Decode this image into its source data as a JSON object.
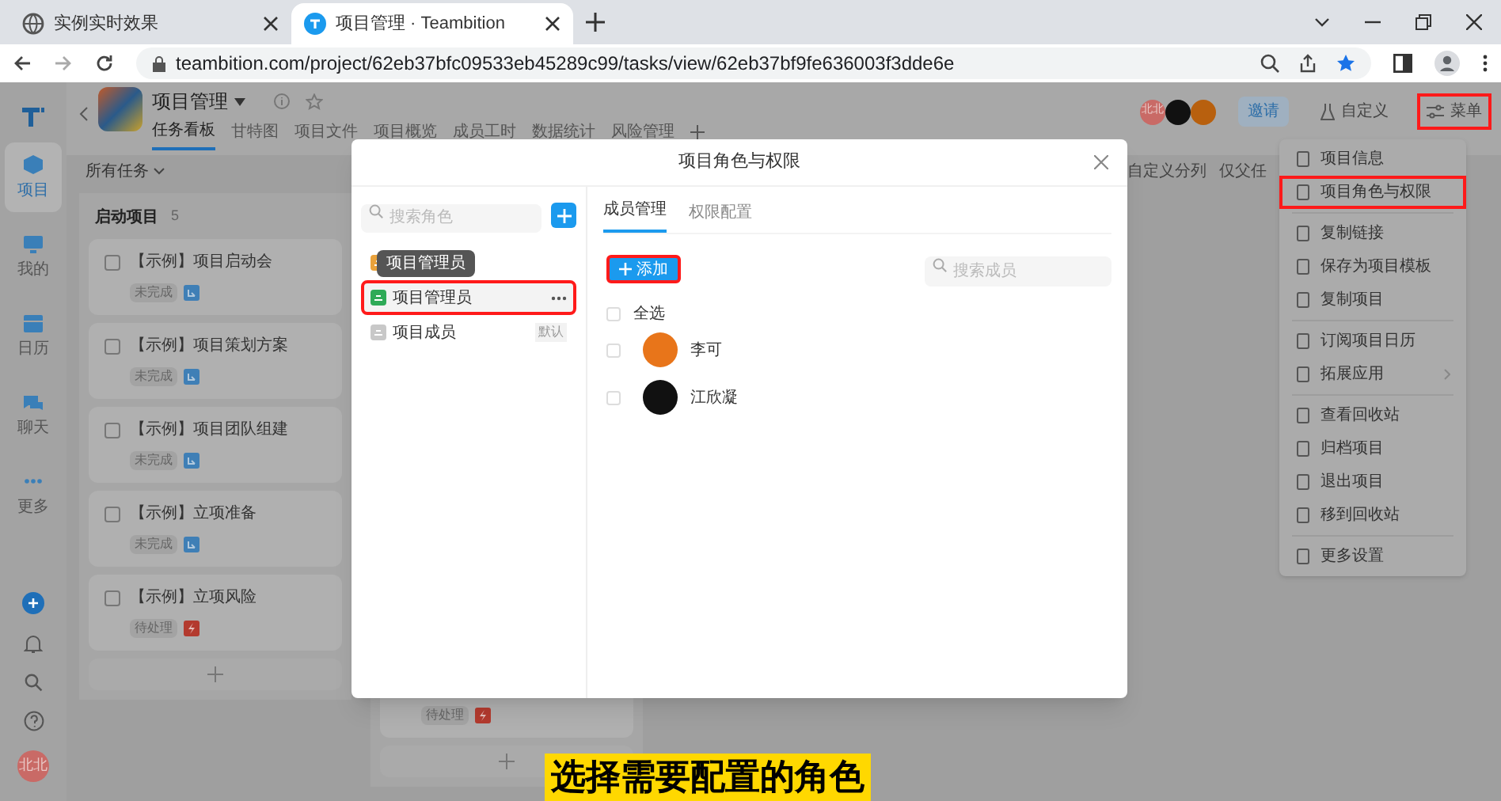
{
  "browser": {
    "tabs": [
      {
        "title": "实例实时效果",
        "selected": false
      },
      {
        "title": "项目管理 · Teambition",
        "selected": true
      }
    ],
    "url": "teambition.com/project/62eb37bfc09533eb45289c99/tasks/view/62eb37bf9fe636003f3dde6e"
  },
  "sidebar": {
    "items": [
      {
        "label": "项目",
        "selected": true
      },
      {
        "label": "我的",
        "selected": false
      },
      {
        "label": "日历",
        "selected": false
      },
      {
        "label": "聊天",
        "selected": false
      },
      {
        "label": "更多",
        "selected": false
      }
    ],
    "avatar": "北北"
  },
  "project": {
    "name": "项目管理",
    "tabs": [
      {
        "label": "任务看板",
        "selected": true
      },
      {
        "label": "甘特图",
        "selected": false
      },
      {
        "label": "项目文件",
        "selected": false
      },
      {
        "label": "项目概览",
        "selected": false
      },
      {
        "label": "成员工时",
        "selected": false
      },
      {
        "label": "数据统计",
        "selected": false
      },
      {
        "label": "风险管理",
        "selected": false
      }
    ],
    "member_avatar": "北北",
    "invite": "邀请",
    "customize": "自定义",
    "menu": {
      "label": "菜单",
      "highlighted": true
    }
  },
  "toolbar": {
    "filter": "所有任务",
    "actions": [
      "自定义分列",
      "仅父任"
    ]
  },
  "columns": [
    {
      "title": "启动项目",
      "count": "5",
      "cards": [
        {
          "title": "【示例】项目启动会",
          "status": "未完成",
          "kind": "task",
          "checked": false
        },
        {
          "title": "【示例】项目策划方案",
          "status": "未完成",
          "kind": "task",
          "checked": false
        },
        {
          "title": "【示例】项目团队组建",
          "status": "未完成",
          "kind": "task",
          "checked": false
        },
        {
          "title": "【示例】立项准备",
          "status": "未完成",
          "kind": "task",
          "checked": false
        },
        {
          "title": "【示例】立项风险",
          "status": "待处理",
          "kind": "risk",
          "checked": false
        }
      ]
    },
    {
      "cards": [
        {
          "status": "待处理",
          "kind": "risk"
        }
      ]
    }
  ],
  "menu": {
    "groups": [
      [
        {
          "label": "项目信息",
          "highlighted": false
        },
        {
          "label": "项目角色与权限",
          "highlighted": true
        }
      ],
      [
        {
          "label": "复制链接",
          "highlighted": false
        },
        {
          "label": "保存为项目模板",
          "highlighted": false
        },
        {
          "label": "复制项目",
          "highlighted": false
        }
      ],
      [
        {
          "label": "订阅项目日历",
          "highlighted": false
        },
        {
          "label": "拓展应用",
          "highlighted": false,
          "submenu": true
        }
      ],
      [
        {
          "label": "查看回收站",
          "highlighted": false
        },
        {
          "label": "归档项目",
          "highlighted": false
        },
        {
          "label": "退出项目",
          "highlighted": false
        },
        {
          "label": "移到回收站",
          "highlighted": false
        }
      ],
      [
        {
          "label": "更多设置",
          "highlighted": false
        }
      ]
    ]
  },
  "dialog": {
    "title": "项目角色与权限",
    "role_search": {
      "placeholder": "搜索角色"
    },
    "tooltip": "项目管理员",
    "roles": [
      {
        "kind": "owner",
        "selected": false,
        "highlighted": false
      },
      {
        "kind": "admin",
        "label": "项目管理员",
        "selected": true,
        "highlighted": true
      },
      {
        "kind": "member",
        "label": "项目成员",
        "badge": "默认",
        "selected": false,
        "highlighted": false
      }
    ],
    "tabs": [
      {
        "label": "成员管理",
        "selected": true
      },
      {
        "label": "权限配置",
        "selected": false
      }
    ],
    "add_button": {
      "label": "添加",
      "highlighted": true
    },
    "member_search": {
      "placeholder": "搜索成员"
    },
    "select_all": {
      "label": "全选",
      "checked": false
    },
    "members": [
      {
        "name": "李可",
        "checked": false,
        "color": "#e8751a"
      },
      {
        "name": "江欣凝",
        "checked": false,
        "color": "#111111"
      }
    ]
  },
  "caption": "选择需要配置的角色"
}
